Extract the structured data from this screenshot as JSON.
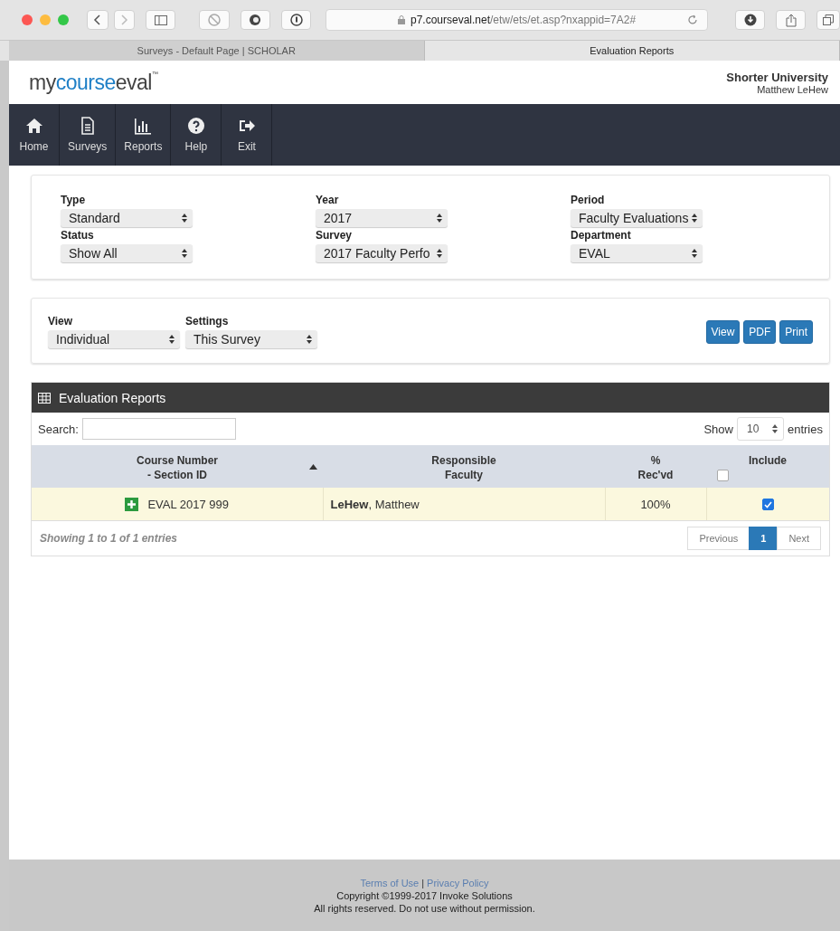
{
  "browser": {
    "url": "**p7.courseval.net**/etw/ets/et.asp?nxappid=7A2#",
    "tabs": [
      {
        "label": "Surveys - Default Page | SCHOLAR",
        "selected": false
      },
      {
        "label": "Evaluation Reports",
        "selected": true
      }
    ]
  },
  "header": {
    "logo": {
      "prefix": "my",
      "accent": "course",
      "suffix": "eval",
      "mark": "™"
    },
    "org": "Shorter University",
    "user": "Matthew LeHew"
  },
  "nav": [
    {
      "kind": "home",
      "label": "Home"
    },
    {
      "kind": "surveys",
      "label": "Surveys"
    },
    {
      "kind": "reports",
      "label": "Reports"
    },
    {
      "kind": "help",
      "label": "Help"
    },
    {
      "kind": "exit",
      "label": "Exit"
    }
  ],
  "filters": [
    {
      "label": "Type",
      "value": "Standard"
    },
    {
      "label": "Year",
      "value": "2017"
    },
    {
      "label": "Period",
      "value": "Faculty Evaluations"
    },
    {
      "label": "Status",
      "value": "Show All"
    },
    {
      "label": "Survey",
      "value": "2017 Faculty Perfo"
    },
    {
      "label": "Department",
      "value": "EVAL"
    }
  ],
  "view_options": [
    {
      "label": "View",
      "value": "Individual"
    },
    {
      "label": "Settings",
      "value": "This Survey"
    }
  ],
  "actions": [
    "View",
    "PDF",
    "Print"
  ],
  "reports": {
    "title": "Evaluation Reports",
    "search_label": "Search:",
    "show_label": "Show",
    "page_size": "10",
    "entries_label": "entries",
    "columns": [
      {
        "lines": [
          "Course Number",
          "- Section ID"
        ],
        "sorted": true
      },
      {
        "lines": [
          "Responsible",
          "Faculty"
        ],
        "sorted": false
      },
      {
        "lines": [
          "%",
          "Rec'vd"
        ],
        "sorted": false
      },
      {
        "lines": [
          "Include"
        ],
        "sorted": false,
        "checkbox": {
          "checked": false
        }
      }
    ],
    "rows": [
      {
        "course": "EVAL 2017 999",
        "faculty": "**LeHew**, Matthew",
        "received": "100%",
        "include": true
      }
    ],
    "info": "Showing 1 to 1 of 1 entries",
    "pagination": [
      {
        "label": "Previous",
        "selected": false
      },
      {
        "label": "1",
        "selected": true
      },
      {
        "label": "Next",
        "selected": false
      }
    ]
  },
  "footer": {
    "links": [
      "Terms of Use",
      "Privacy Policy"
    ],
    "separator": "|",
    "lines": [
      "Copyright ©1999-2017 Invoke Solutions",
      "All rights reserved. Do not use without permission."
    ]
  }
}
